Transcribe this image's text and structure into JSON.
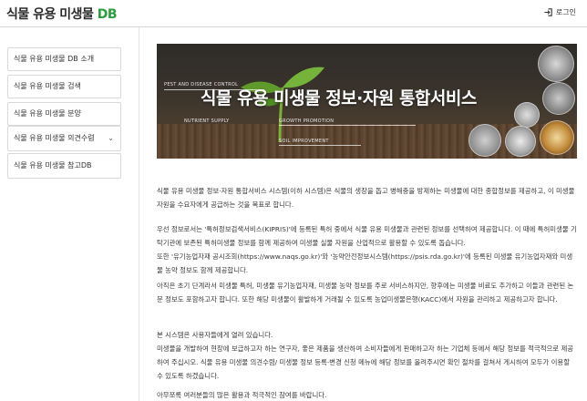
{
  "header": {
    "brand_main": "식물 유용 미생물",
    "brand_suffix": "DB",
    "login_label": "로그인",
    "login_icon": "login-icon"
  },
  "sidebar": {
    "items": [
      {
        "label": "식물 유용 미생물 DB 소개"
      },
      {
        "label": "식물 유용 미생물 검색"
      },
      {
        "label": "식물 유용 미생물 분양"
      },
      {
        "label": "식물 유용 미생물 의견수렴",
        "chevron": "⌄"
      },
      {
        "label": "식물 유용 미생물 참고DB"
      }
    ]
  },
  "banner": {
    "title": "식물 유용 미생물 정보·자원 통합서비스",
    "tags": [
      "PEST AND DISEASE CONTROL",
      "NUTRIENT SUPPLY",
      "GROWTH PROMOTION",
      "SOIL IMPROVEMENT"
    ]
  },
  "content": {
    "para1": "식물 유용 미생물 정보·자원 통합서비스 시스템(이하 시스템)은 식물의 생장을 돕고 병해충을 방제하는 미생물에 대한 종합정보를 제공하고, 이 미생물 자원을 수요자에게 공급하는 것을 목표로 합니다.",
    "para2_l1": "우선 정보로서는 '특허정보검색서비스(KIPRIS)'에 등록된 특허 중에서 식물 유용 미생물과 관련된 정보를 선택하여 제공합니다. 이 때에 특허미생물 기탁기관에 보존된 특허미생물 정보를 함께 제공하여 미생물 실물 자원을 산업적으로 활용할 수 있도록 돕습니다.",
    "para2_l2": "또한 '유기농업자재 공시조회(https://www.naqs.go.kr)'와 '농약안전정보시스템(https://psis.rda.go.kr)'에 등록된 미생물 유기농업자재와 미생물 농약 정보도 함께 제공합니다.",
    "para3": "아직은 초기 단계라서 미생물 특허, 미생물 유기농업자재, 미생물 농약 정보를 주로 서비스하지만, 향후에는 미생물 비료도 추가하고 이들과 관련된 논문 정보도 포함하고자 합니다. 또한 해당 미생물이 활발하게 거래될 수 있도록 농업미생물은행(KACC)에서 자원을 관리하고 제공하고자 합니다.",
    "para4_l1": "본 시스템은 사용자들에게 열려 있습니다.",
    "para4_l2": "미생물을 개발하여 현장에 보급하고자 하는 연구자, 좋은 제품을 생산하여 소비자들에게 판매하고자 하는 기업체 등에서 해당 정보를 적극적으로 제공하여 주십시오. 식물 유용 미생물 의견수렴/ 미생물 정보 등록·변경 신청 메뉴에 해당 정보를 올려주시면 확인 절차를 걸쳐서 게시하여 모두가 이용할 수 있도록 하겠습니다.",
    "para5": "아무쪼록 여러분들의 많은 활용과 적극적인 참여를 바랍니다."
  }
}
